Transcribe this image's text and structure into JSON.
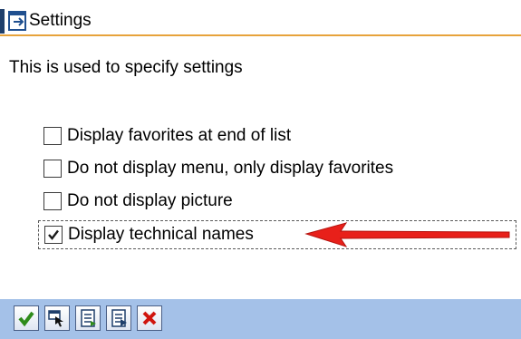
{
  "window": {
    "title": "Settings"
  },
  "description": "This is used to specify settings",
  "options": [
    {
      "label": "Display favorites at end of list",
      "checked": false
    },
    {
      "label": "Do not display menu, only display favorites",
      "checked": false
    },
    {
      "label": "Do not display picture",
      "checked": false
    },
    {
      "label": "Display technical names",
      "checked": true
    }
  ],
  "toolbar": {
    "buttons": [
      {
        "icon": "check-icon"
      },
      {
        "icon": "select-icon"
      },
      {
        "icon": "list-icon"
      },
      {
        "icon": "list-detail-icon"
      },
      {
        "icon": "cancel-icon"
      }
    ]
  },
  "colors": {
    "title_underline": "#e7a33b",
    "toolbar_bg": "#a4c1e8",
    "arrow": "#e8201a"
  }
}
